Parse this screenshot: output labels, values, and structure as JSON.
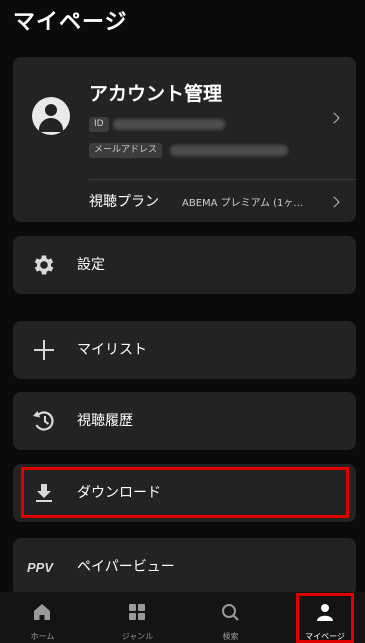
{
  "page": {
    "title": "マイページ"
  },
  "account": {
    "title": "アカウント管理",
    "id_label": "ID",
    "mail_label": "メールアドレス",
    "plan_label": "視聴プラン",
    "plan_value": "ABEMA プレミアム (1ヶ..."
  },
  "menu": {
    "settings": "設定",
    "mylist": "マイリスト",
    "history": "視聴履歴",
    "download": "ダウンロード",
    "ppv_icon_text": "PPV",
    "ppv": "ペイパービュー"
  },
  "nav": {
    "home": "ホーム",
    "genre": "ジャンル",
    "search": "検索",
    "mypage": "マイページ"
  },
  "colors": {
    "highlight": "#e00000",
    "card": "#232323",
    "background": "#0b0b0b"
  }
}
